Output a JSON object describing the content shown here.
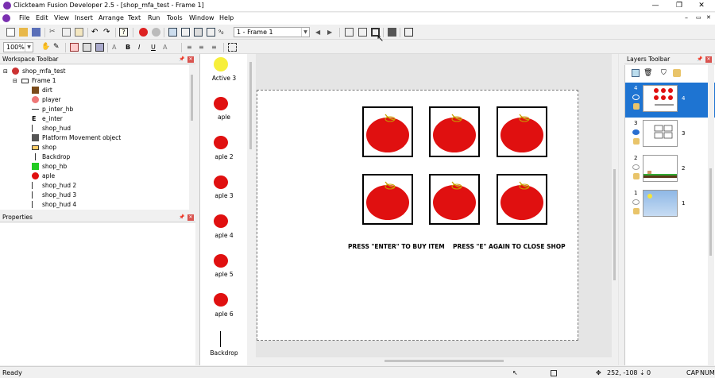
{
  "titlebar": {
    "title": "Clickteam Fusion Developer 2.5 - [shop_mfa_test - Frame 1]",
    "minimize": "—",
    "maximize": "❐",
    "close": "✕"
  },
  "mdi_controls": {
    "minimize": "–",
    "restore": "▭",
    "close": "✕"
  },
  "menu": [
    "File",
    "Edit",
    "View",
    "Insert",
    "Arrange",
    "Text",
    "Run",
    "Tools",
    "Window",
    "Help"
  ],
  "toolbar": {
    "frame_select": "1 - Frame 1",
    "zoom": "100%"
  },
  "workspace": {
    "title": "Workspace Toolbar",
    "tree": [
      {
        "label": "shop_mfa_test",
        "icon": "app-icon"
      },
      {
        "label": "Frame 1",
        "icon": "frame-icon"
      },
      {
        "label": "dirt",
        "icon": "dirt-icon"
      },
      {
        "label": "player",
        "icon": "player-icon"
      },
      {
        "label": "p_inter_hb",
        "icon": "line-icon"
      },
      {
        "label": "e_inter",
        "icon": "e-icon"
      },
      {
        "label": "shop_hud",
        "icon": "line-icon"
      },
      {
        "label": "Platform Movement object",
        "icon": "platform-icon"
      },
      {
        "label": "shop",
        "icon": "shop-icon"
      },
      {
        "label": "Backdrop",
        "icon": "line-icon"
      },
      {
        "label": "shop_hb",
        "icon": "green-square-icon"
      },
      {
        "label": "aple",
        "icon": "apple-icon"
      },
      {
        "label": "shop_hud 2",
        "icon": "line-icon"
      },
      {
        "label": "shop_hud 3",
        "icon": "line-icon"
      },
      {
        "label": "shop_hud 4",
        "icon": "line-icon"
      }
    ]
  },
  "properties": {
    "title": "Properties"
  },
  "objects": [
    {
      "label": "Active 3",
      "icon": "yellow-circle-icon"
    },
    {
      "label": "aple",
      "icon": "red-circle-icon"
    },
    {
      "label": "aple 2",
      "icon": "red-circle-icon"
    },
    {
      "label": "aple 3",
      "icon": "red-circle-icon"
    },
    {
      "label": "aple 4",
      "icon": "red-circle-icon"
    },
    {
      "label": "aple 5",
      "icon": "red-circle-icon"
    },
    {
      "label": "aple 6",
      "icon": "red-circle-icon"
    },
    {
      "label": "Backdrop",
      "icon": "backdrop-line-icon"
    }
  ],
  "frame": {
    "text_left": "PRESS \"ENTER\" TO BUY ITEM",
    "text_right": "PRESS \"E\" AGAIN TO CLOSE SHOP",
    "colors": {
      "apple": "#e01010",
      "slot_border": "#000000",
      "frame_bg": "#ffffff",
      "editor_bg": "#e5e5e5"
    }
  },
  "layers": {
    "title": "Layers Toolbar",
    "items": [
      {
        "num": "4",
        "index": "4",
        "selected": true
      },
      {
        "num": "3",
        "index": "3",
        "selected": false
      },
      {
        "num": "2",
        "index": "2",
        "selected": false
      },
      {
        "num": "1",
        "index": "1",
        "selected": false
      }
    ],
    "selected_color": "#1e74d2"
  },
  "status": {
    "left": "Ready",
    "coords": "252, -108",
    "count": "0",
    "caps": "CAP",
    "num": "NUM"
  }
}
